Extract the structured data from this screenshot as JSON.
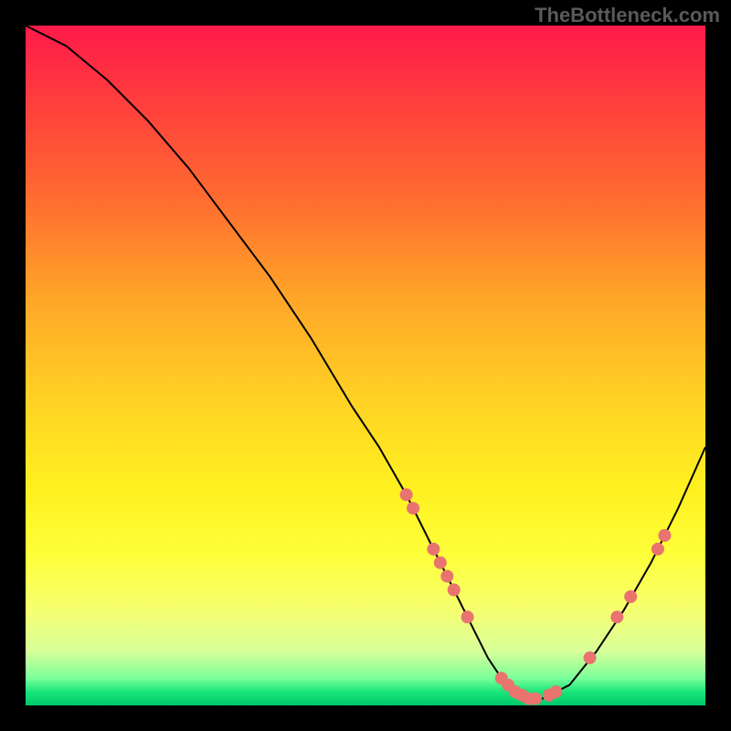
{
  "watermark": "TheBottleneck.com",
  "chart_data": {
    "type": "line",
    "title": "",
    "xlabel": "",
    "ylabel": "",
    "xlim": [
      0,
      100
    ],
    "ylim": [
      0,
      100
    ],
    "series": [
      {
        "name": "curve",
        "x": [
          0,
          6,
          12,
          18,
          24,
          30,
          36,
          42,
          48,
          52,
          56,
          58,
          60,
          62,
          64,
          66,
          68,
          70,
          72,
          74,
          76,
          80,
          84,
          88,
          92,
          96,
          100
        ],
        "y": [
          100,
          97,
          92,
          86,
          79,
          71,
          63,
          54,
          44,
          38,
          31,
          27,
          23,
          19,
          15,
          11,
          7,
          4,
          2,
          1,
          1,
          3,
          8,
          14,
          21,
          29,
          38
        ]
      }
    ],
    "markers": [
      {
        "x": 56,
        "y": 31
      },
      {
        "x": 57,
        "y": 29
      },
      {
        "x": 60,
        "y": 23
      },
      {
        "x": 61,
        "y": 21
      },
      {
        "x": 62,
        "y": 19
      },
      {
        "x": 63,
        "y": 17
      },
      {
        "x": 65,
        "y": 13
      },
      {
        "x": 70,
        "y": 4
      },
      {
        "x": 71,
        "y": 3
      },
      {
        "x": 72,
        "y": 2
      },
      {
        "x": 73,
        "y": 1.5
      },
      {
        "x": 74,
        "y": 1
      },
      {
        "x": 75,
        "y": 1
      },
      {
        "x": 77,
        "y": 1.5
      },
      {
        "x": 78,
        "y": 2
      },
      {
        "x": 83,
        "y": 7
      },
      {
        "x": 87,
        "y": 13
      },
      {
        "x": 89,
        "y": 16
      },
      {
        "x": 93,
        "y": 23
      },
      {
        "x": 94,
        "y": 25
      }
    ],
    "gradient_stops": [
      {
        "pos": 0,
        "color": "#ff1a4a"
      },
      {
        "pos": 25,
        "color": "#ff6a30"
      },
      {
        "pos": 55,
        "color": "#ffd224"
      },
      {
        "pos": 78,
        "color": "#feff3a"
      },
      {
        "pos": 96,
        "color": "#7aff9a"
      },
      {
        "pos": 100,
        "color": "#00c86a"
      }
    ]
  }
}
